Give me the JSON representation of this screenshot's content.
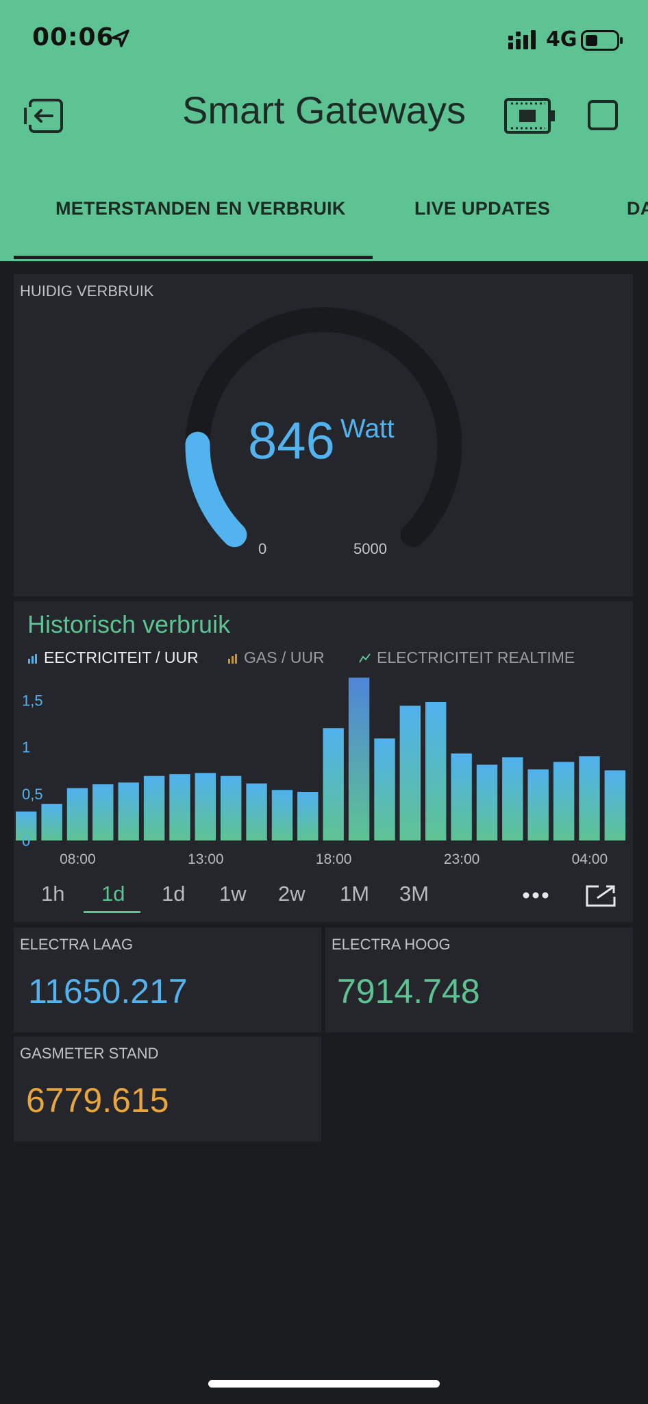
{
  "status_bar": {
    "time": "00:06",
    "network": "4G"
  },
  "header": {
    "title": "Smart Gateways"
  },
  "tabs": [
    {
      "label": "METERSTANDEN EN VERBRUIK",
      "active": true
    },
    {
      "label": "LIVE UPDATES",
      "active": false
    },
    {
      "label": "DA",
      "active": false
    }
  ],
  "gauge": {
    "label": "HUIDIG VERBRUIK",
    "value": "846",
    "unit": "Watt",
    "min": "0",
    "max": "5000",
    "color": "#52b3ef"
  },
  "history": {
    "title": "Historisch verbruik",
    "legend": [
      {
        "label": "EECTRICITEIT / UUR",
        "active": true
      },
      {
        "label": "GAS / UUR",
        "active": false
      },
      {
        "label": "ELECTRICITEIT REALTIME",
        "active": false
      }
    ],
    "ranges": [
      "1h",
      "1d",
      "1d",
      "1w",
      "2w",
      "1M",
      "3M"
    ],
    "active_range_index": 1
  },
  "chart_data": {
    "type": "bar",
    "title": "Historisch verbruik",
    "series_name": "EECTRICITEIT / UUR",
    "x_tick_labels": [
      "08:00",
      "13:00",
      "18:00",
      "23:00",
      "04:00"
    ],
    "y_tick_labels": [
      "0",
      "0,5",
      "1",
      "1,5"
    ],
    "ylim": [
      0,
      1.7
    ],
    "values": [
      0.31,
      0.39,
      0.56,
      0.6,
      0.62,
      0.69,
      0.71,
      0.72,
      0.69,
      0.61,
      0.54,
      0.52,
      1.2,
      1.74,
      1.09,
      1.44,
      1.48,
      0.93,
      0.81,
      0.89,
      0.76,
      0.84,
      0.9,
      0.75
    ],
    "grid": false
  },
  "meters": {
    "electra_laag": {
      "label": "ELECTRA LAAG",
      "value": "11650.217",
      "color": "#52b3ef"
    },
    "electra_hoog": {
      "label": "ELECTRA HOOG",
      "value": "7914.748",
      "color": "#5ec393"
    },
    "gas": {
      "label": "GASMETER STAND",
      "value": "6779.615",
      "color": "#eaa63c"
    }
  }
}
